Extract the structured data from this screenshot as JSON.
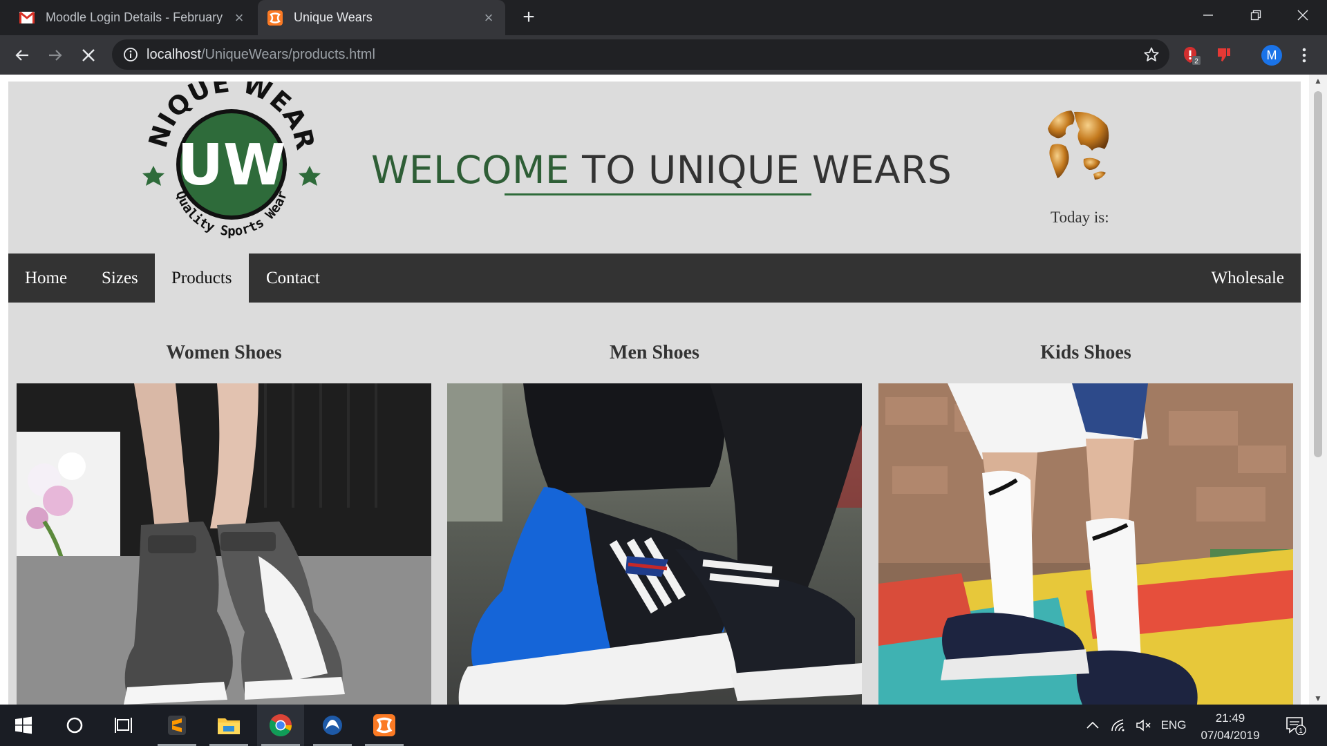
{
  "browser": {
    "tabs": [
      {
        "title": "Moodle Login Details - February",
        "active": false,
        "icon": "gmail-icon"
      },
      {
        "title": "Unique Wears",
        "active": true,
        "icon": "xampp-icon"
      }
    ],
    "url_host": "localhost",
    "url_path": "/UniqueWears/products.html",
    "extension_badge": "2",
    "profile_initial": "M"
  },
  "site": {
    "logo": {
      "top_text": "UNIQUE WEARS",
      "monogram": "UW",
      "bottom_text": "Quality Sports Wear"
    },
    "welcome": {
      "part1": "WELCOME",
      "part2": "TO UNIQUE WEARS"
    },
    "today_label": "Today is:",
    "nav": {
      "items": [
        {
          "label": "Home",
          "active": false
        },
        {
          "label": "Sizes",
          "active": false
        },
        {
          "label": "Products",
          "active": true
        },
        {
          "label": "Contact",
          "active": false
        }
      ],
      "right_item": "Wholesale"
    },
    "categories": [
      {
        "title": "Women Shoes"
      },
      {
        "title": "Men Shoes"
      },
      {
        "title": "Kids Shoes"
      }
    ]
  },
  "taskbar": {
    "language": "ENG",
    "time": "21:49",
    "date": "07/04/2019",
    "notification_count": "1"
  },
  "colors": {
    "brand_green": "#2e5e36",
    "nav_bg": "#333333",
    "page_bg": "#dcdcdc"
  }
}
